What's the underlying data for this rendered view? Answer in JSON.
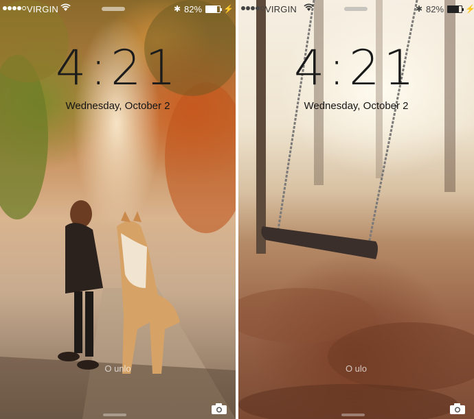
{
  "screens": [
    {
      "status": {
        "carrier": "VIRGIN",
        "battery_percent": "82%",
        "battery_level": 0.82
      },
      "lock": {
        "time": "4:21",
        "date": "Wednesday, October 2",
        "unlock_text": "O unlo"
      },
      "icons": {
        "signal": "signal-dots-icon",
        "wifi": "wifi-icon",
        "bluetooth": "bluetooth-icon",
        "battery": "battery-icon",
        "charging": "charging-bolt-icon",
        "camera": "camera-icon"
      },
      "wallpaper": "girl-and-dog-autumn-path"
    },
    {
      "status": {
        "carrier": "VIRGIN",
        "battery_percent": "82%",
        "battery_level": 0.82
      },
      "lock": {
        "time": "4:21",
        "date": "Wednesday, October 2",
        "unlock_text": "O ulo"
      },
      "icons": {
        "signal": "signal-dots-icon",
        "wifi": "wifi-icon",
        "bluetooth": "bluetooth-icon",
        "battery": "battery-icon",
        "charging": "charging-bolt-icon",
        "camera": "camera-icon"
      },
      "wallpaper": "swing-in-autumn-leaves"
    }
  ]
}
